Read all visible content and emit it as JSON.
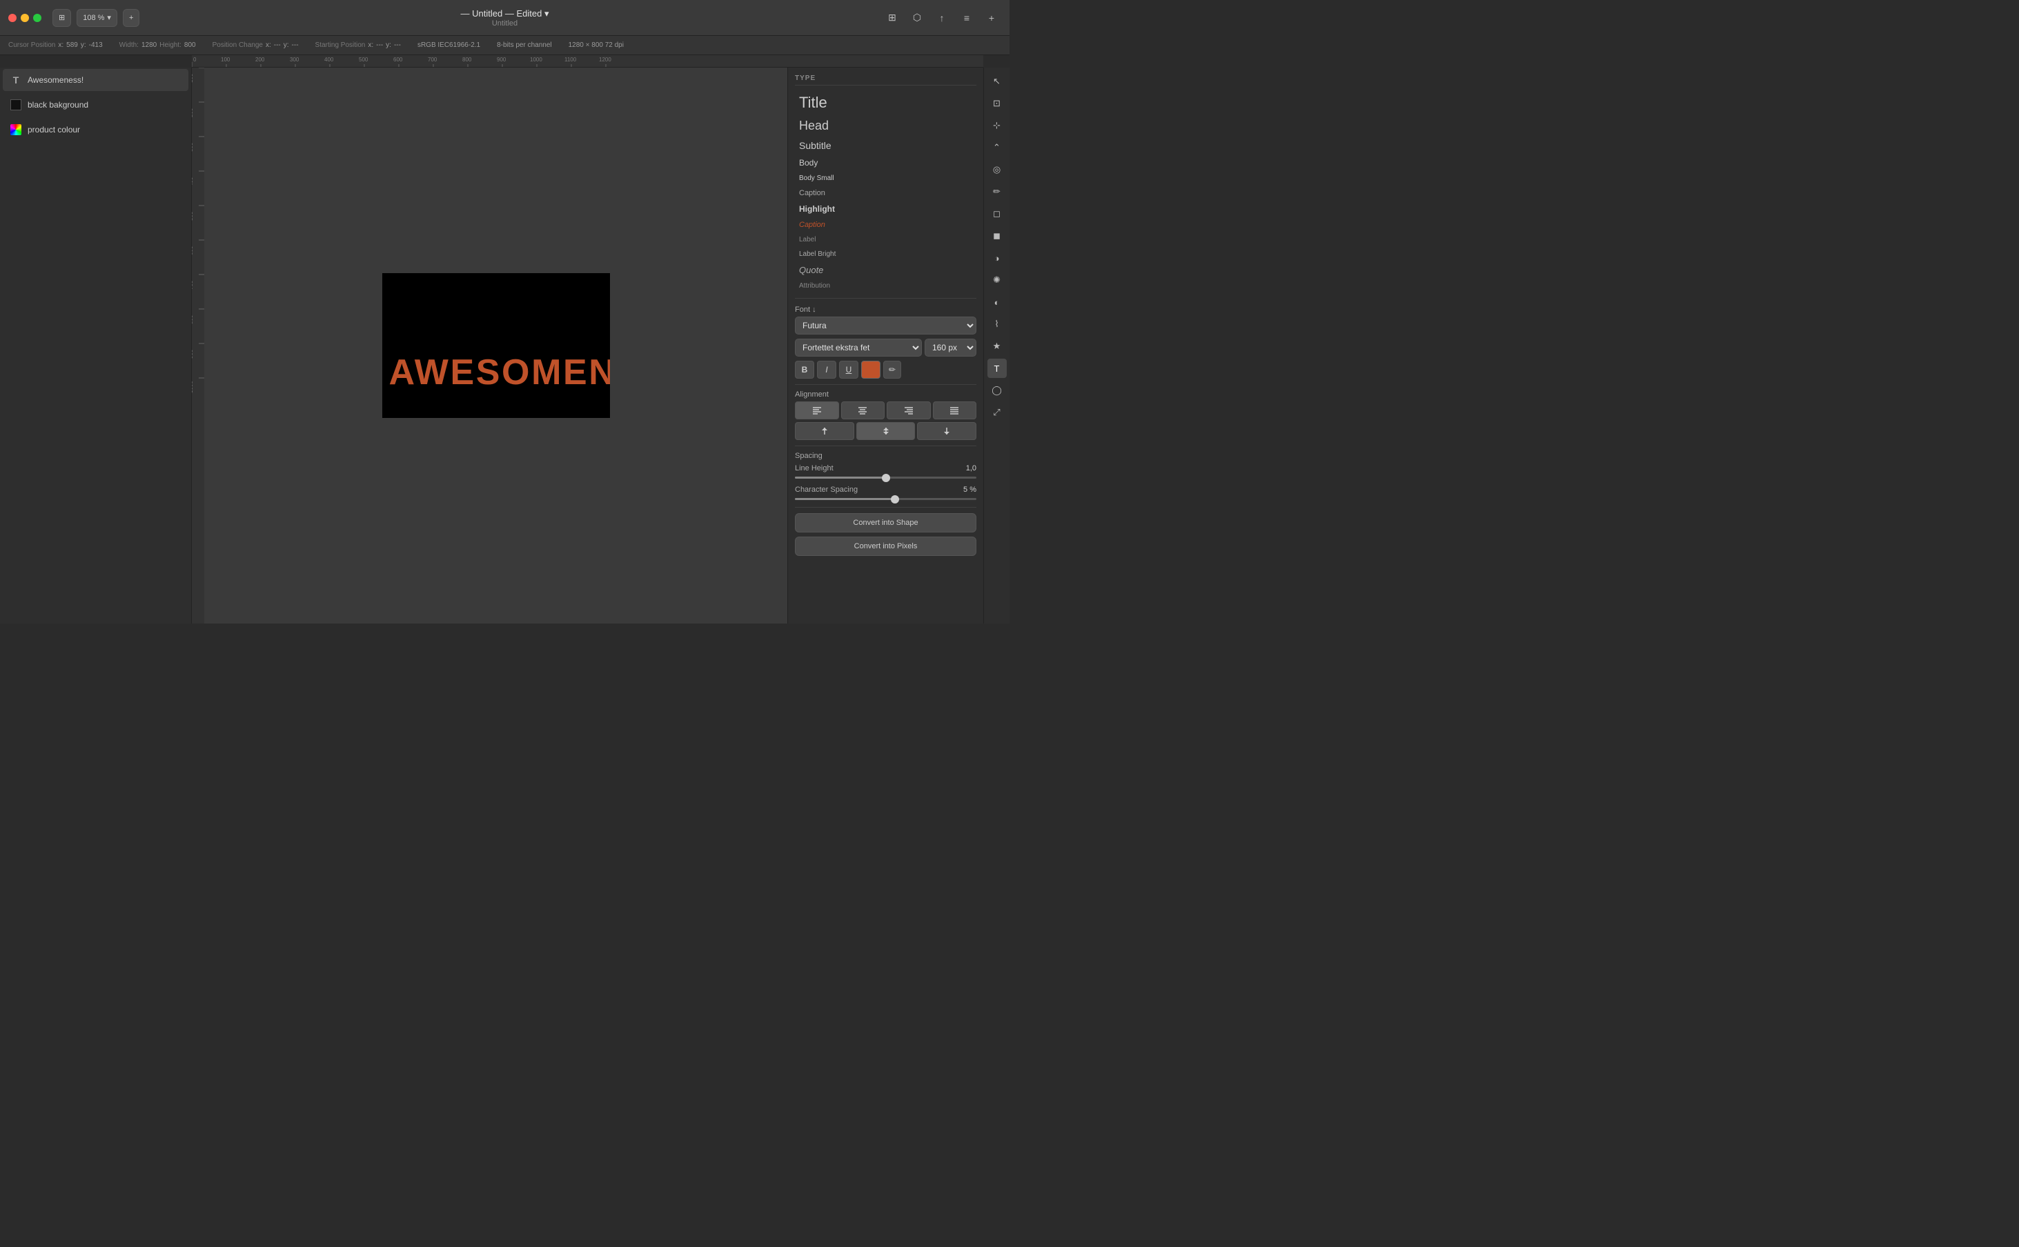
{
  "titlebar": {
    "close": "×",
    "minimize": "−",
    "maximize": "+",
    "view_btn": "⊞",
    "zoom": "108 %",
    "add_btn": "+",
    "title": "Untitled — Edited",
    "subtitle": "Untitled",
    "share_icon": "↑",
    "export_icon": "⬜",
    "layout_icon": "⊞",
    "settings_icon": "≡",
    "add_panel_btn": "+"
  },
  "statusbar": {
    "cursor_label": "Cursor Position",
    "x_label": "x:",
    "x_val": "589",
    "y_label": "y:",
    "y_val": "-413",
    "width_label": "Width:",
    "width_val": "1280",
    "height_label": "Height:",
    "height_val": "800",
    "pos_change_label": "Position Change",
    "px_label": "x:",
    "px_val": "---",
    "py_label": "y:",
    "py_val": "---",
    "start_pos_label": "Starting Position",
    "sx_label": "x:",
    "sx_val": "---",
    "sy_label": "y:",
    "sy_val": "---",
    "colorspace": "sRGB IEC61966-2.1",
    "bitdepth": "8-bits per channel",
    "dimensions": "1280 × 800 72 dpi"
  },
  "layers": [
    {
      "id": "awesomeness",
      "icon": "T",
      "label": "Awesomeness!"
    },
    {
      "id": "black-bg",
      "icon": "rect",
      "label": "black bakground"
    },
    {
      "id": "product-colour",
      "icon": "color",
      "label": "product colour"
    }
  ],
  "canvas": {
    "text": "Awesomeness!"
  },
  "type_panel": {
    "section": "TYPE",
    "font_section": "Font ↓",
    "font_family": "Futura",
    "font_weight": "Fortettet ekstra fet",
    "font_size": "160 px",
    "bold": "B",
    "italic": "I",
    "underline": "U",
    "alignment_label": "Alignment",
    "align_left": "≡",
    "align_center": "≡",
    "align_right": "≡",
    "align_justify": "≡",
    "valign_top": "⬆",
    "valign_middle": "⬆",
    "valign_bottom": "⬇",
    "spacing_label": "Spacing",
    "line_height_label": "Line Height",
    "line_height_val": "1,0",
    "line_height_pct": 50,
    "char_spacing_label": "Character Spacing",
    "char_spacing_val": "5 %",
    "char_spacing_pct": 55,
    "convert_shape": "Convert into Shape",
    "convert_pixels": "Convert into Pixels"
  },
  "style_list": [
    {
      "id": "title",
      "label": "Title",
      "class": "style-title"
    },
    {
      "id": "head",
      "label": "Head",
      "class": "style-head"
    },
    {
      "id": "subtitle",
      "label": "Subtitle",
      "class": "style-subtitle"
    },
    {
      "id": "body",
      "label": "Body",
      "class": "style-body"
    },
    {
      "id": "body-small",
      "label": "Body Small",
      "class": "style-body-small"
    },
    {
      "id": "caption",
      "label": "Caption",
      "class": "style-caption"
    },
    {
      "id": "highlight",
      "label": "Highlight",
      "class": "style-highlight"
    },
    {
      "id": "caption-orange",
      "label": "Caption",
      "class": "style-caption-orange"
    },
    {
      "id": "label",
      "label": "Label",
      "class": "style-label"
    },
    {
      "id": "label-bright",
      "label": "Label Bright",
      "class": "style-label-bright"
    },
    {
      "id": "quote",
      "label": "Quote",
      "class": "style-quote"
    },
    {
      "id": "attribution",
      "label": "Attribution",
      "class": "style-attribution"
    }
  ],
  "tools": [
    {
      "id": "select",
      "icon": "↖",
      "label": "select-tool"
    },
    {
      "id": "crop",
      "icon": "⊡",
      "label": "crop-tool"
    },
    {
      "id": "select2",
      "icon": "⊹",
      "label": "select2-tool"
    },
    {
      "id": "lasso",
      "icon": "⌃",
      "label": "lasso-tool"
    },
    {
      "id": "paint",
      "icon": "◎",
      "label": "paint-tool"
    },
    {
      "id": "pen",
      "icon": "✏",
      "label": "pen-tool"
    },
    {
      "id": "erase",
      "icon": "◻",
      "label": "erase-tool"
    },
    {
      "id": "erase2",
      "icon": "◼",
      "label": "erase2-tool"
    },
    {
      "id": "fill",
      "icon": "◑",
      "label": "fill-tool"
    },
    {
      "id": "sun",
      "icon": "✺",
      "label": "sun-tool"
    },
    {
      "id": "adjust",
      "icon": "◐",
      "label": "adjust-tool"
    },
    {
      "id": "brush",
      "icon": "⌇",
      "label": "brush-tool"
    },
    {
      "id": "star",
      "icon": "★",
      "label": "star-tool"
    },
    {
      "id": "text",
      "icon": "T",
      "label": "text-tool",
      "active": true
    },
    {
      "id": "shape",
      "icon": "◯",
      "label": "shape-tool"
    },
    {
      "id": "transform",
      "icon": "⤢",
      "label": "transform-tool"
    }
  ]
}
